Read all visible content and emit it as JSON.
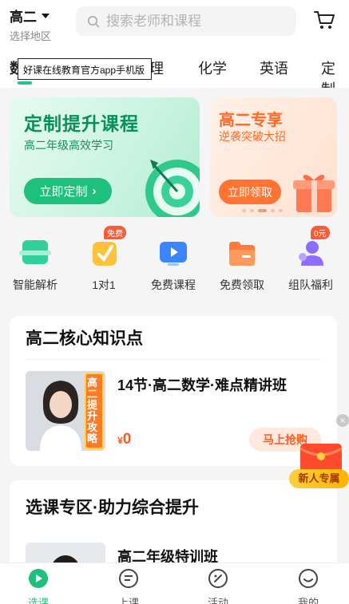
{
  "header": {
    "grade": "高二",
    "region_prompt": "选择地区",
    "search_placeholder": "搜索老师和课程"
  },
  "tabs": [
    {
      "label": "数",
      "active": true
    },
    {
      "label": "物理",
      "active": false
    },
    {
      "label": "化学",
      "active": false
    },
    {
      "label": "英语",
      "active": false
    },
    {
      "label": "定制",
      "active": false
    }
  ],
  "tooltip": "好课在线教育官方app手机版",
  "banners": {
    "main": {
      "title": "定制提升课程",
      "subtitle": "高二年级高效学习",
      "button": "立即定制"
    },
    "side": {
      "title": "高二专享",
      "subtitle": "逆袭突破大招",
      "button": "立即领取"
    }
  },
  "quick_entries": [
    {
      "label": "智能解析",
      "icon": "analysis-icon",
      "badge": ""
    },
    {
      "label": "1对1",
      "icon": "one-on-one-icon",
      "badge": "免费"
    },
    {
      "label": "免费课程",
      "icon": "video-course-icon",
      "badge": ""
    },
    {
      "label": "免费领取",
      "icon": "folder-icon",
      "badge": ""
    },
    {
      "label": "组队福利",
      "icon": "team-icon",
      "badge": "0元"
    }
  ],
  "section1": {
    "title": "高二核心知识点",
    "course": {
      "title": "14节·高二数学·难点精讲班",
      "thumb_text": "高二提升攻略",
      "currency": "¥",
      "price": "0",
      "button": "马上抢购"
    }
  },
  "section2": {
    "title": "选课专区·助力综合提升",
    "course": {
      "title": "高二年级特训班"
    }
  },
  "floating": {
    "close": "×",
    "label": "新人专属"
  },
  "bottom_nav": [
    {
      "label": "选课",
      "icon": "course-select-icon",
      "active": true
    },
    {
      "label": "上课",
      "icon": "class-icon",
      "active": false
    },
    {
      "label": "活动",
      "icon": "activity-icon",
      "active": false
    },
    {
      "label": "我的",
      "icon": "profile-icon",
      "active": false
    }
  ],
  "colors": {
    "accent": "#1ec07d",
    "orange": "#ff6a2a",
    "price": "#ff5b1c"
  }
}
